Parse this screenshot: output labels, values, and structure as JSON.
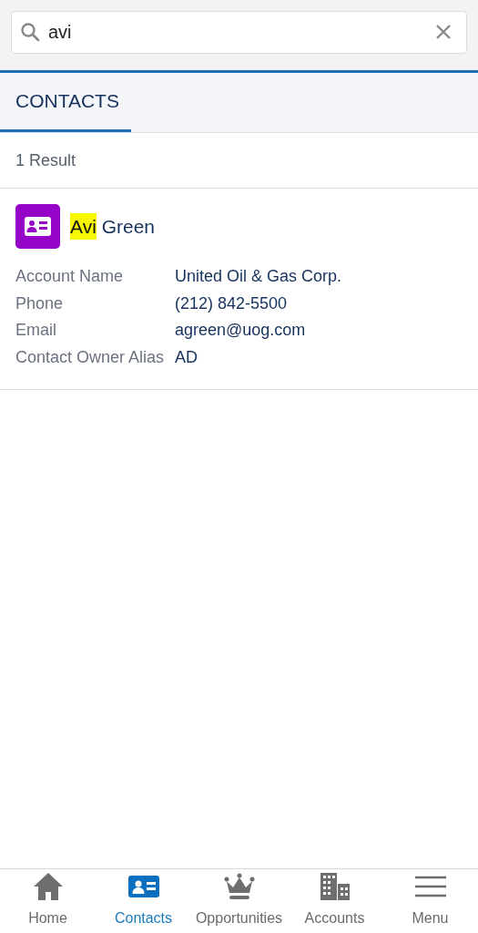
{
  "search": {
    "value": "avi"
  },
  "tabs": [
    {
      "label": "CONTACTS",
      "selected": true
    }
  ],
  "result_count": "1 Result",
  "results": [
    {
      "name_parts": [
        {
          "text": "Avi",
          "highlighted": true
        },
        {
          "text": " Green",
          "highlighted": false
        }
      ],
      "fields": [
        {
          "label": "Account Name",
          "value": "United Oil & Gas Corp."
        },
        {
          "label": "Phone",
          "value": "(212) 842-5500"
        },
        {
          "label": "Email",
          "value": "agreen@uog.com"
        },
        {
          "label": "Contact Owner Alias",
          "value": "AD"
        }
      ]
    }
  ],
  "bottom_nav": [
    {
      "label": "Home",
      "selected": false
    },
    {
      "label": "Contacts",
      "selected": true
    },
    {
      "label": "Opportunities",
      "selected": false
    },
    {
      "label": "Accounts",
      "selected": false
    },
    {
      "label": "Menu",
      "selected": false
    }
  ]
}
